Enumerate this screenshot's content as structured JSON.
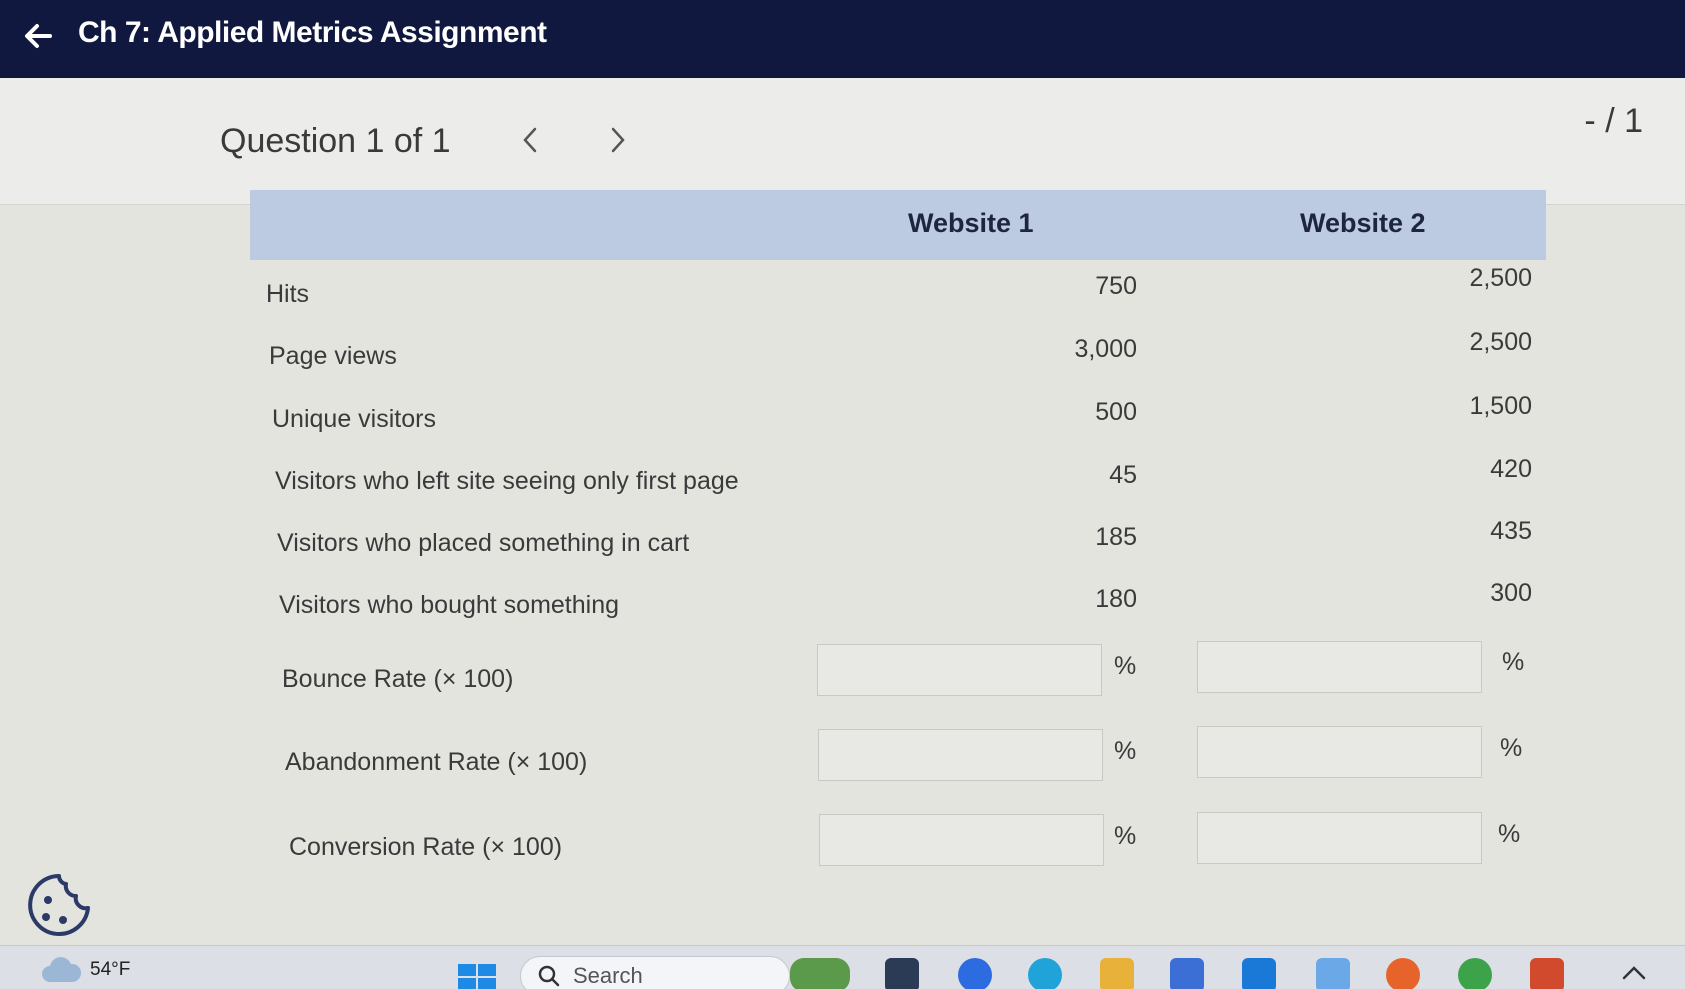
{
  "header": {
    "title": "Ch 7: Applied Metrics Assignment"
  },
  "question": {
    "label": "Question 1 of 1",
    "score": "- / 1"
  },
  "table": {
    "columns": [
      "Website 1",
      "Website 2"
    ],
    "rows": [
      {
        "label": "Hits",
        "w1": "750",
        "w2": "2,500"
      },
      {
        "label": "Page views",
        "w1": "3,000",
        "w2": "2,500"
      },
      {
        "label": "Unique visitors",
        "w1": "500",
        "w2": "1,500"
      },
      {
        "label": "Visitors who left site seeing only first page",
        "w1": "45",
        "w2": "420"
      },
      {
        "label": "Visitors who placed something in cart",
        "w1": "185",
        "w2": "435"
      },
      {
        "label": "Visitors who bought something",
        "w1": "180",
        "w2": "300"
      }
    ],
    "inputs": [
      {
        "label": "Bounce Rate (× 100)",
        "w1": "",
        "w2": "",
        "unit": "%"
      },
      {
        "label": "Abandonment Rate (× 100)",
        "w1": "",
        "w2": "",
        "unit": "%"
      },
      {
        "label": "Conversion Rate (× 100)",
        "w1": "",
        "w2": "",
        "unit": "%"
      }
    ]
  },
  "taskbar": {
    "weather": "54°F",
    "search_placeholder": "Search",
    "icons": [
      "start-icon",
      "search-icon",
      "widgets-icon",
      "task-view-icon",
      "zoom-icon",
      "edge-icon",
      "file-explorer-icon",
      "store-icon",
      "mail-icon",
      "snipping-tool-icon",
      "firefox-icon",
      "chrome-icon",
      "powerpoint-icon",
      "chevron-up-icon"
    ]
  },
  "colors": {
    "header_bg": "#10183f",
    "table_header_bg": "#bccbe2",
    "page_bg": "#e4e4df"
  }
}
